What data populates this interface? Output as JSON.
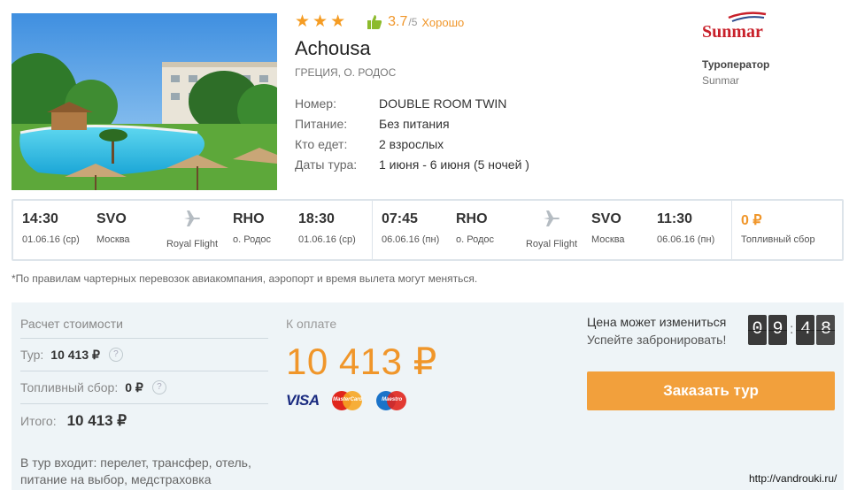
{
  "hotel": {
    "stars": [
      "★",
      "★",
      "★"
    ],
    "rating": "3.7",
    "rating_max": "/5",
    "rating_word": "Хорошо",
    "name": "Achousa",
    "location": "ГРЕЦИЯ, О. РОДОС",
    "details": [
      {
        "label": "Номер:",
        "value": "DOUBLE ROOM TWIN"
      },
      {
        "label": "Питание:",
        "value": "Без питания"
      },
      {
        "label": "Кто едет:",
        "value": "2 взрослых"
      },
      {
        "label": "Даты тура:",
        "value": "1 июня - 6 июня (5 ночей )"
      }
    ]
  },
  "operator": {
    "logo_text": "Sunmar",
    "label": "Туроператор",
    "name": "Sunmar"
  },
  "flights": {
    "outbound": {
      "dep_time": "14:30",
      "dep_date": "01.06.16 (ср)",
      "dep_code": "SVO",
      "dep_city": "Москва",
      "airline": "Royal Flight",
      "arr_code": "RHO",
      "arr_city": "о. Родос",
      "arr_time": "18:30",
      "arr_date": "01.06.16 (ср)"
    },
    "return": {
      "dep_time": "07:45",
      "dep_date": "06.06.16 (пн)",
      "dep_code": "RHO",
      "dep_city": "о. Родос",
      "airline": "Royal Flight",
      "arr_code": "SVO",
      "arr_city": "Москва",
      "arr_time": "11:30",
      "arr_date": "06.06.16 (пн)"
    },
    "fuel_fee": "0 ₽",
    "fuel_fee_label": "Топливный сбор"
  },
  "notice": "*По правилам чартерных перевозок авиакомпания, аэропорт и время вылета могут меняться.",
  "calc": {
    "title": "Расчет стоимости",
    "tour_label": "Тур:",
    "tour_value": "10 413 ₽",
    "fuel_label": "Топливный сбор:",
    "fuel_value": "0 ₽",
    "help": "?",
    "total_label": "Итого:",
    "total_value": "10 413 ₽",
    "includes": "В тур входит: перелет, трансфер, отель, питание на выбор, медстраховка"
  },
  "payment": {
    "label": "К оплате",
    "amount": "10 413 ₽",
    "visa": "VISA",
    "mastercard": "MasterCard",
    "maestro": "Maestro"
  },
  "promo": {
    "line1": "Цена может измениться",
    "line2": "Успейте забронировать!",
    "timer": [
      "0",
      "9",
      "4",
      "8"
    ],
    "button": "Заказать тур"
  },
  "watermark": "http://vandrouki.ru/",
  "colors": {
    "accent": "#f0962a",
    "button": "#f2a03c",
    "panel_bg": "#eef4f7",
    "border": "#dde4ea"
  }
}
